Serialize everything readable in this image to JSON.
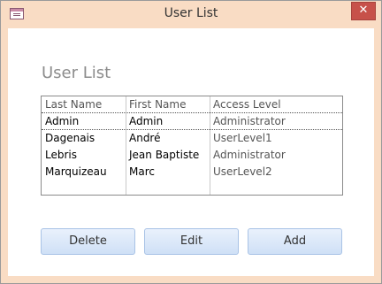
{
  "window": {
    "title": "User List",
    "close_label": "✕"
  },
  "form": {
    "title": "User List"
  },
  "list": {
    "columns": [
      "Last Name",
      "First Name",
      "Access Level"
    ],
    "rows": [
      [
        "Admin",
        "Admin",
        "Administrator"
      ],
      [
        "Dagenais",
        "André",
        "UserLevel1"
      ],
      [
        "Lebris",
        "Jean Baptiste",
        "Administrator"
      ],
      [
        "Marquizeau",
        "Marc",
        "UserLevel2"
      ]
    ]
  },
  "buttons": {
    "delete": "Delete",
    "edit": "Edit",
    "add": "Add"
  },
  "colors": {
    "title_bar": "#f9dcc4",
    "close_button": "#c7514a",
    "button_fill": "#d9e6f8"
  }
}
